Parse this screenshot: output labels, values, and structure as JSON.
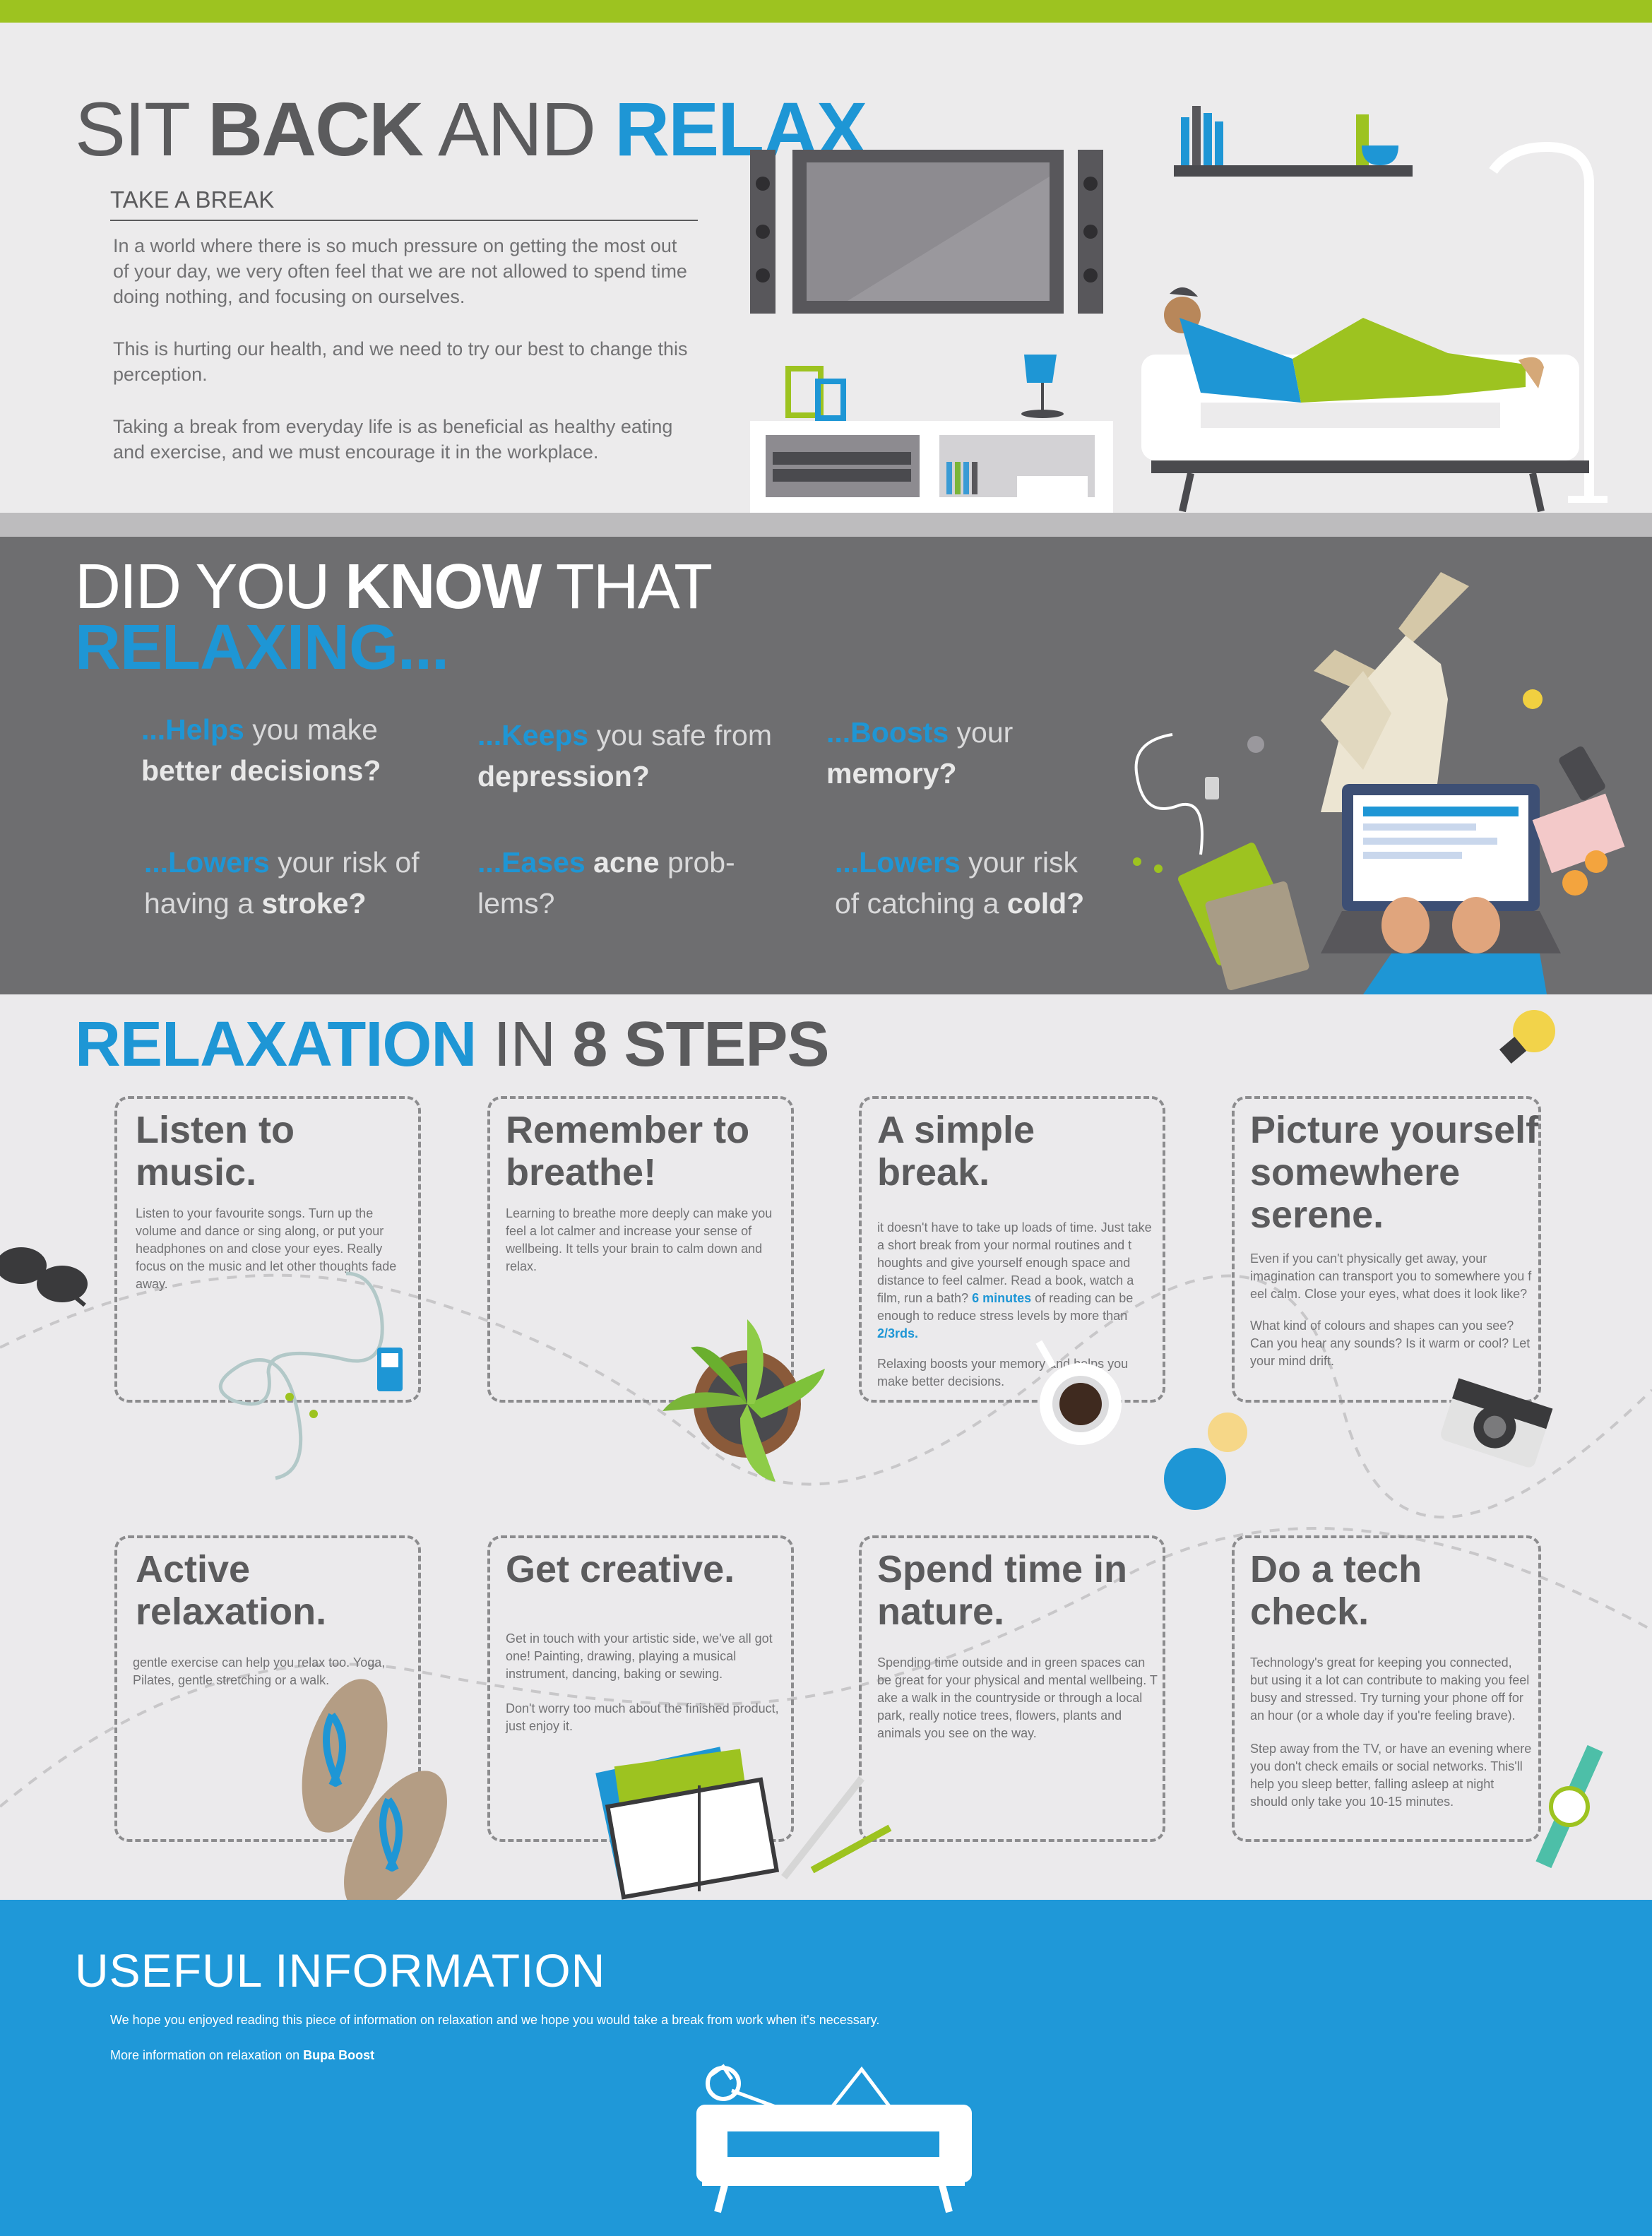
{
  "colors": {
    "green": "#9dc320",
    "blue": "#1e96d5",
    "dark_grey": "#6e6e70",
    "text_grey": "#5b5b5d"
  },
  "hero": {
    "title_part1": "SIT ",
    "title_part2": "BACK",
    "title_part3": " AND ",
    "title_part4": "RELAX",
    "subheading": "TAKE A BREAK",
    "para1": "In a world where there is so much pressure on getting the most out of your day, we very often feel that we are not allowed to spend time doing nothing, and focusing on ourselves.",
    "para2": "This is hurting our health, and we need to try our best to change this perception.",
    "para3": "Taking a break from everyday life is as beneficial as healthy eating and exercise, and we must encourage it in the workplace."
  },
  "dyk": {
    "title_part1": "DID YOU ",
    "title_part2": "KNOW",
    "title_part3": " THAT",
    "subtitle": "RELAXING...",
    "facts": [
      {
        "kw": "...Helps",
        "text1": " you make",
        "bold": "better decisions?",
        "text2": ""
      },
      {
        "kw": "...Keeps",
        "text1": " you safe from",
        "bold": "depression?",
        "text2": ""
      },
      {
        "kw": "...Boosts",
        "text1": " your",
        "bold": "memory?",
        "text2": ""
      },
      {
        "kw": "...Lowers",
        "text1": " your risk of having a ",
        "bold": "stroke?",
        "text2": ""
      },
      {
        "kw": "...Eases",
        "text1": " ",
        "bold": "acne",
        "text2": " prob-lems?"
      },
      {
        "kw": "...Lowers",
        "text1": " your risk of catching a ",
        "bold": "cold?",
        "text2": ""
      }
    ]
  },
  "steps": {
    "title_part1": "RELAXATION",
    "title_part2": " IN ",
    "title_part3": "8 STEPS",
    "cards": [
      {
        "title": "Listen to music.",
        "text": "Listen to your favourite songs. Turn up the volume and dance or sing along, or put your headphones on and close your eyes. Really focus on the music and let other thoughts fade away."
      },
      {
        "title": "Remember to breathe!",
        "text": "Learning to breathe more deeply can make you feel a lot calmer and increase your sense of wellbeing.  It tells your brain to calm down and relax."
      },
      {
        "title": "A simple break.",
        "text_a": "it doesn't have to take up loads of time. Just take a short break from your normal routines and t houghts and give yourself enough space and distance to feel calmer. Read a book, watch a film, run a bath? ",
        "hl1": "6 minutes",
        "text_b": " of reading can be enough to reduce stress levels by more than ",
        "hl2": "2/3rds.",
        "text_c": "Relaxing boosts your memory and helps you make better decisions."
      },
      {
        "title": "Picture yourself somewhere serene.",
        "text": "Even if you can't physically get away, your imagination can transport you to somewhere you f eel calm. Close your eyes, what does it look like?",
        "text2": "What kind of colours and shapes can you see? Can you hear any sounds? Is it warm or cool? Let your mind drift."
      },
      {
        "title": "Active relaxation.",
        "text": "gentle exercise can help you relax too. Yoga, Pilates, gentle stretching or a walk."
      },
      {
        "title": "Get creative.",
        "text": "Get in touch with your artistic side, we've all got one! Painting, drawing, playing a musical instrument, dancing, baking or sewing.",
        "text2": "Don't worry too much about the finished product, just enjoy it."
      },
      {
        "title": "Spend time in nature.",
        "text": "Spending time outside and in green spaces can be great for your physical and mental wellbeing. T ake a walk in the countryside or through a local park, really notice trees, flowers, plants and animals you see on the way."
      },
      {
        "title": "Do a tech check.",
        "text": "Technology's great for keeping you connected, but using it a lot can contribute to making you feel busy and stressed. Try turning your phone off for an hour (or a whole day if you're feeling brave).",
        "text2": "Step away from the TV, or have an evening where you don't check emails or social networks. This'll help you sleep better, falling asleep at night should only take you 10-15 minutes."
      }
    ]
  },
  "useful": {
    "title": "USEFUL INFORMATION",
    "line1": "We hope you enjoyed reading this piece of information on relaxation and we hope you would take a break from  work when it's necessary.",
    "line2_prefix": "More information on relaxation on ",
    "line2_bold": "Bupa Boost"
  }
}
